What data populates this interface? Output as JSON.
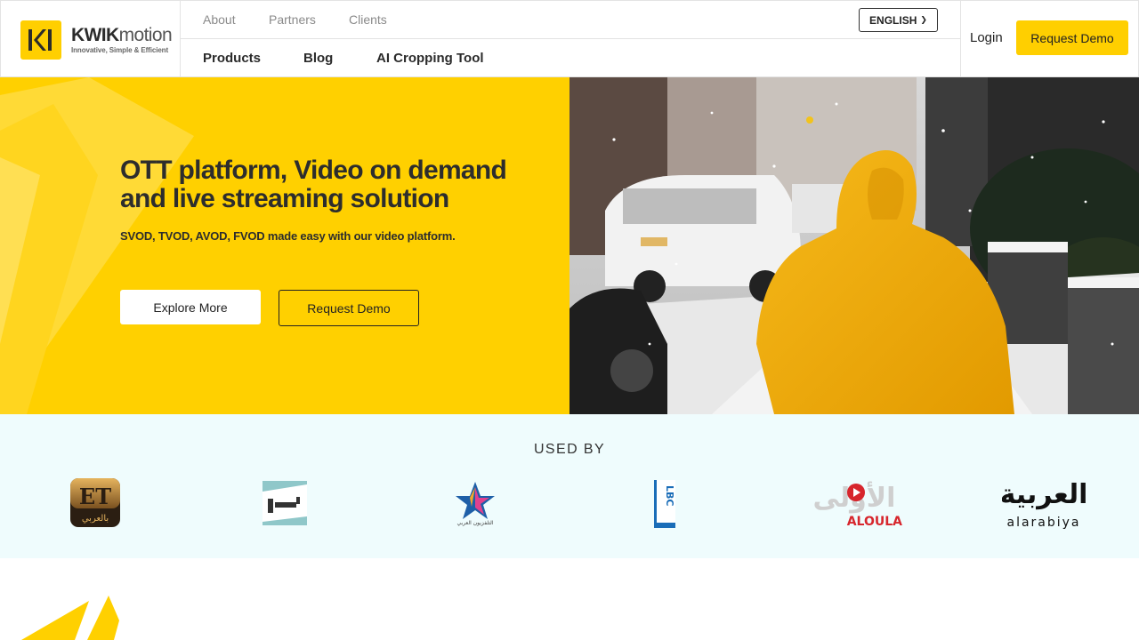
{
  "brand": {
    "name_bold": "KWIK",
    "name_light": "motion",
    "tagline": "Innovative, Simple & Efficient",
    "accent": "#ffd000"
  },
  "nav_top": {
    "about": "About",
    "partners": "Partners",
    "clients": "Clients",
    "language": "ENGLISH"
  },
  "nav_main": {
    "products": "Products",
    "blog": "Blog",
    "ai_tool": "AI Cropping Tool"
  },
  "header_actions": {
    "login": "Login",
    "request_demo": "Request Demo"
  },
  "hero": {
    "title": "OTT platform, Video on demand and live streaming solution",
    "subtitle": "SVOD, TVOD, AVOD, FVOD made easy with our video platform.",
    "explore_button": "Explore More",
    "demo_button": "Request Demo"
  },
  "used_by": {
    "title": "USED BY",
    "clients": [
      {
        "name": "ET بالعربي",
        "logo_text": "ET",
        "logo_sub": "بالعربي"
      },
      {
        "name": "LPIV",
        "logo_text": "ﻟﻴﺒﻴﺎ"
      },
      {
        "name": "التلفزيون العربي",
        "logo_text": "التلفزيون العربي"
      },
      {
        "name": "LBC",
        "logo_text": "LBC"
      },
      {
        "name": "ALOULA",
        "logo_text": "ALOULA",
        "logo_arabic": "الأولى"
      },
      {
        "name": "alarabiya",
        "logo_text": "alarabiya",
        "logo_arabic": "العربية"
      }
    ]
  }
}
